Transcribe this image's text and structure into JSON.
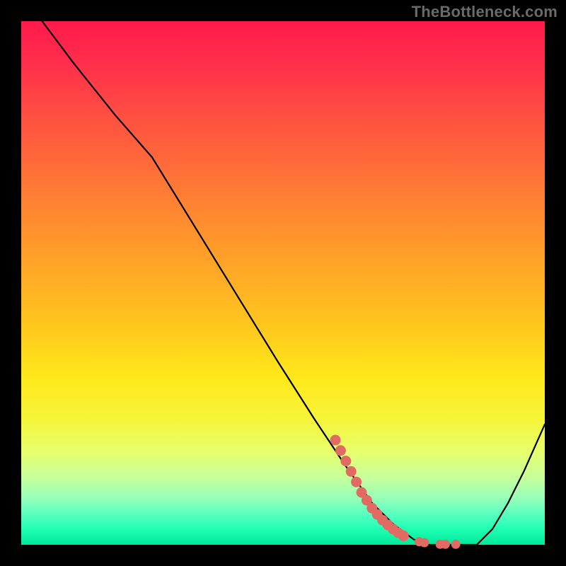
{
  "watermark": "TheBottleneck.com",
  "colors": {
    "background": "#000000",
    "line": "#000000",
    "dot_fill": "#e16a63",
    "dot_stroke": "#b94e47"
  },
  "chart_data": {
    "type": "line",
    "title": "",
    "xlabel": "",
    "ylabel": "",
    "xlim": [
      0,
      100
    ],
    "ylim": [
      0,
      100
    ],
    "grid": false,
    "legend": false,
    "series": [
      {
        "name": "bottleneck-curve",
        "x": [
          4,
          10,
          18,
          25,
          33,
          41,
          49,
          56,
          62,
          67,
          71,
          75,
          78,
          81,
          84,
          87,
          90,
          93,
          96,
          100
        ],
        "y": [
          100,
          92,
          82,
          74,
          61,
          48,
          35,
          24,
          15,
          8,
          4,
          1,
          0,
          0,
          0,
          0,
          3,
          8,
          14,
          23
        ]
      }
    ],
    "highlight_dots": {
      "name": "optimal-region-dots",
      "points": [
        {
          "x": 60,
          "y": 20
        },
        {
          "x": 61,
          "y": 18
        },
        {
          "x": 62,
          "y": 16
        },
        {
          "x": 63,
          "y": 14
        },
        {
          "x": 64,
          "y": 12
        },
        {
          "x": 65,
          "y": 10
        },
        {
          "x": 66,
          "y": 8.5
        },
        {
          "x": 67,
          "y": 7
        },
        {
          "x": 68,
          "y": 5.8
        },
        {
          "x": 69,
          "y": 4.7
        },
        {
          "x": 70,
          "y": 3.8
        },
        {
          "x": 71,
          "y": 3.0
        },
        {
          "x": 72,
          "y": 2.3
        },
        {
          "x": 73,
          "y": 1.7
        },
        {
          "x": 76,
          "y": 0.6
        },
        {
          "x": 77,
          "y": 0.4
        },
        {
          "x": 80,
          "y": 0.1
        },
        {
          "x": 81,
          "y": 0.1
        },
        {
          "x": 83,
          "y": 0.1
        }
      ]
    }
  }
}
